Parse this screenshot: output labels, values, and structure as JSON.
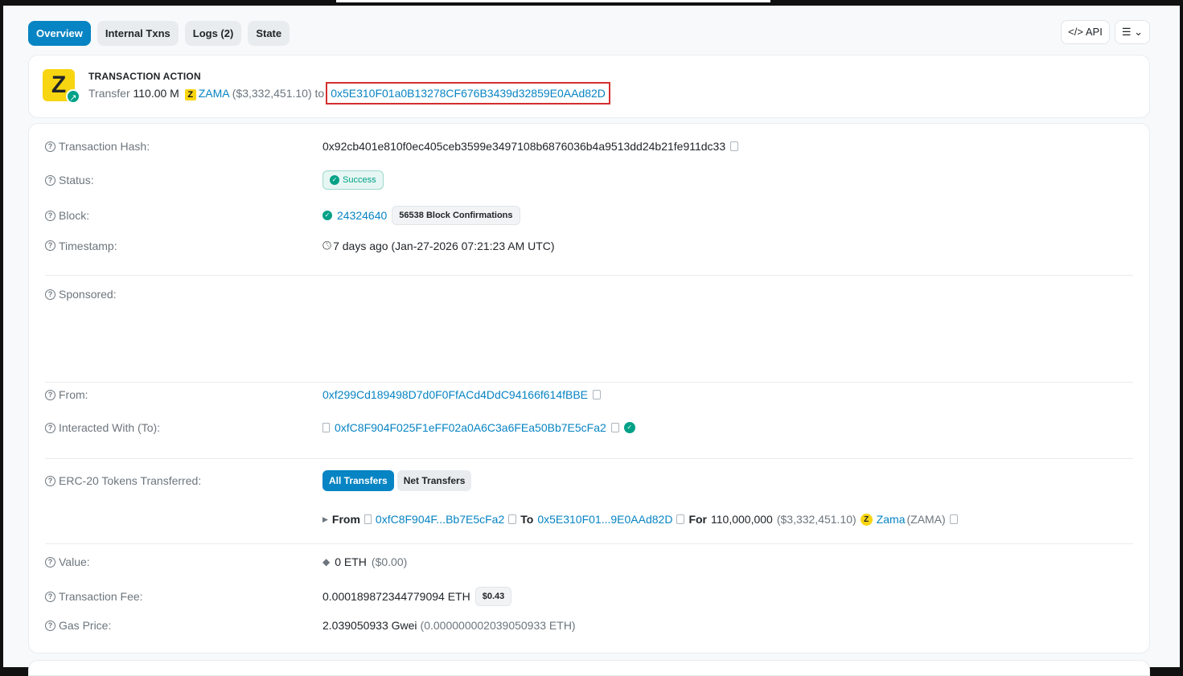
{
  "tabs": [
    "Overview",
    "Internal Txns",
    "Logs (2)",
    "State"
  ],
  "tools": {
    "api": "API",
    "menu": "☰ ⌄"
  },
  "action": {
    "title": "TRANSACTION ACTION",
    "verb": "Transfer",
    "amount": "110.00 M",
    "token_logo": "Z",
    "token": "ZAMA",
    "usd": "($3,332,451.10)",
    "to_word": "to",
    "to_address": "0x5E310F01a0B13278CF676B3439d32859E0AAd82D"
  },
  "rows": {
    "hash": {
      "label": "Transaction Hash:",
      "value": "0x92cb401e810f0ec405ceb3599e3497108b6876036b4a9513dd24b21fe911dc33"
    },
    "status": {
      "label": "Status:",
      "value": "Success"
    },
    "block": {
      "label": "Block:",
      "value": "24324640",
      "confirmations": "56538 Block Confirmations"
    },
    "timestamp": {
      "label": "Timestamp:",
      "value": "7 days ago (Jan-27-2026 07:21:23 AM UTC)"
    },
    "sponsored": {
      "label": "Sponsored:"
    },
    "from": {
      "label": "From:",
      "value": "0xf299Cd189498D7d0F0FfACd4DdC94166f614fBBE"
    },
    "to": {
      "label": "Interacted With (To):",
      "value": "0xfC8F904F025F1eFF02a0A6C3a6FEa50Bb7E5cFa2"
    },
    "erc20": {
      "label": "ERC-20 Tokens Transferred:",
      "all": "All Transfers",
      "net": "Net Transfers",
      "from_word": "From",
      "from": "0xfC8F904F...Bb7E5cFa2",
      "to_word": "To",
      "to": "0x5E310F01...9E0AAd82D",
      "for_word": "For",
      "amount": "110,000,000",
      "usd": "($3,332,451.10)",
      "token_logo": "Z",
      "token": "Zama",
      "symbol": "(ZAMA)"
    },
    "value": {
      "label": "Value:",
      "value": "0 ETH",
      "usd": "($0.00)"
    },
    "fee": {
      "label": "Transaction Fee:",
      "value": "0.000189872344779094 ETH",
      "usd": "$0.43"
    },
    "gas": {
      "label": "Gas Price:",
      "value": "2.039050933 Gwei",
      "eth": "(0.000000002039050933 ETH)"
    }
  }
}
